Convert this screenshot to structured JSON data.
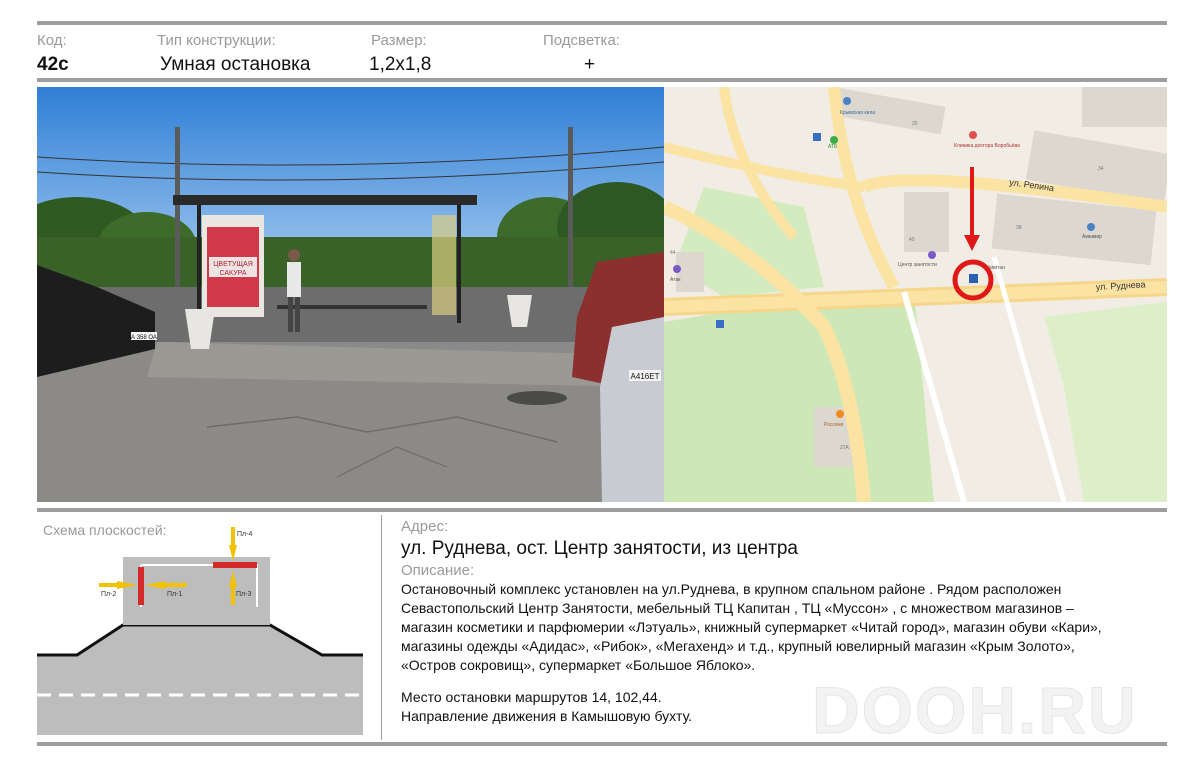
{
  "header": {
    "code_label": "Код:",
    "code_value": "42с",
    "type_label": "Тип конструкции:",
    "type_value": "Умная остановка",
    "size_label": "Размер:",
    "size_value": "1,2х1,8",
    "light_label": "Подсветка:",
    "light_value": "+"
  },
  "photo": {
    "poster_line1": "ЦВЕТУЩАЯ",
    "poster_line2": "САКУРА",
    "plate_left": "А 358 ОА",
    "plate_right": "А416ЕТ"
  },
  "map": {
    "street_repina": "ул. Репина",
    "street_rudneva": "ул. Руднева",
    "poi_klinika": "Клиника доктора Воробьёва",
    "poi_atb": "АТБ",
    "poi_center": "Центр занятости",
    "poi_kapitan": "Капитан",
    "poi_akvamir": "Аквамир",
    "poi_ekvator": "Экватор",
    "poi_atlas": "Атак",
    "poi_kryms": "Крымская кила",
    "poi_rossini": "Россини",
    "bld_25": "25",
    "bld_34": "34",
    "bld_40": "40",
    "bld_38": "38",
    "bld_44": "44",
    "bld_27a": "27А"
  },
  "scheme": {
    "title": "Схема плоскостей:",
    "p1": "Пл-1",
    "p2": "Пл-2",
    "p3": "Пл-3",
    "p4": "Пл-4"
  },
  "info": {
    "address_label": "Адрес:",
    "address": "ул. Руднева, ост. Центр занятости, из центра",
    "description_label": "Описание:",
    "description_lines": [
      "Остановочный комплекс установлен на ул.Руднева, в крупном спальном районе . Рядом расположен",
      "Севастопольский Центр Занятости,  мебельный ТЦ Капитан , ТЦ «Муссон» , с множеством магазинов –",
      "магазин косметики и парфюмерии «Лэтуаль», книжный супермаркет «Читай город», магазин обуви «Кари»,",
      " магазины одежды  «Адидас», «Рибок», «Мегахенд» и т.д., крупный  ювелирный магазин «Крым Золото»,",
      "«Остров сокровищ», супермаркет «Большое Яблоко»."
    ],
    "routes": "Место остановки маршрутов 14, 102,44.",
    "direction": "Направление движения в Камышовую бухту."
  },
  "watermark": "DOOH.RU",
  "colors": {
    "rule": "#9e9e9e",
    "road": "#bdbdbd",
    "plane_red": "#d42a2a",
    "plane_arrow": "#f2c200",
    "map_marker": "#e01818"
  }
}
